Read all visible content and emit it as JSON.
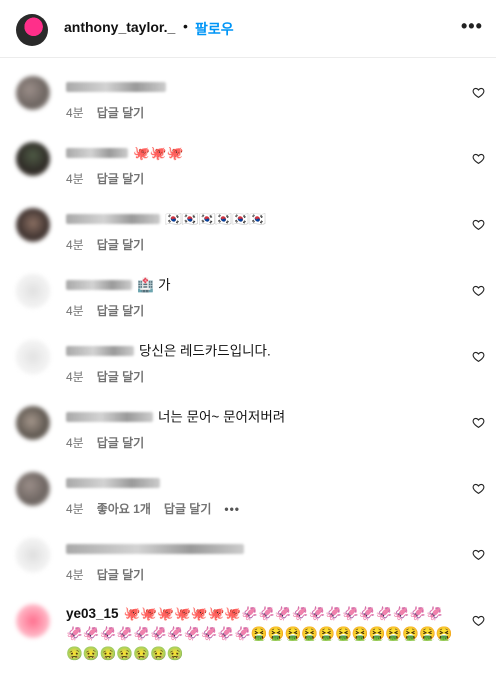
{
  "header": {
    "username": "anthony_taylor._",
    "separator": "•",
    "follow_label": "팔로우",
    "more_label": "•••"
  },
  "comments": [
    {
      "text": "",
      "time": "4분",
      "reply": "답글 달기"
    },
    {
      "text": "🐙🐙🐙",
      "time": "4분",
      "reply": "답글 달기"
    },
    {
      "text": "🇰🇷🇰🇷🇰🇷🇰🇷🇰🇷🇰🇷",
      "time": "4분",
      "reply": "답글 달기"
    },
    {
      "text": "🏥 가",
      "time": "4분",
      "reply": "답글 달기"
    },
    {
      "text": "당신은 레드카드입니다.",
      "time": "4분",
      "reply": "답글 달기"
    },
    {
      "text": "너는 문어~ 문어저버려",
      "time": "4분",
      "reply": "답글 달기"
    },
    {
      "text": "",
      "time": "4분",
      "likes": "좋아요 1개",
      "reply": "답글 달기",
      "more": "•••"
    },
    {
      "text": "",
      "time": "4분",
      "reply": "답글 달기"
    }
  ],
  "last_comment": {
    "username": "ye03_15",
    "text": "🐙🐙🐙🐙🐙🐙🐙🦑🦑🦑🦑🦑🦑🦑🦑🦑🦑🦑🦑🦑🦑🦑🦑🦑🦑🦑🦑🦑🦑🦑🤮🤮🤮🤮🤮🤮🤮🤮🤮🤮🤮🤮🤢🤢🤢🤢🤢🤢🤢"
  },
  "icons": {
    "heart": "heart-outline-icon",
    "more": "more-horizontal-icon"
  }
}
